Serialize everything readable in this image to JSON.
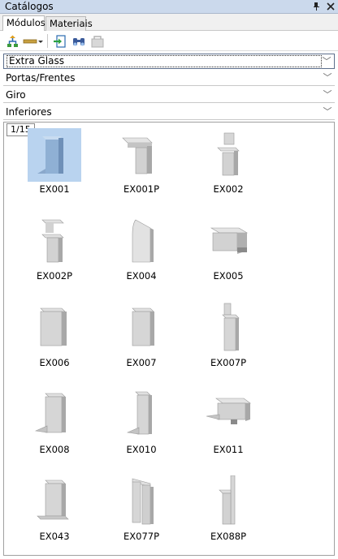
{
  "window": {
    "title": "Catálogos",
    "pin_icon": "pin-icon",
    "close_icon": "close-icon"
  },
  "tabs": [
    {
      "label": "Módulos",
      "active": true
    },
    {
      "label": "Materiais",
      "active": false
    }
  ],
  "toolbar": {
    "buttons": [
      "tree-up-icon",
      "ruler-dropdown-icon",
      "insert-icon",
      "binoculars-icon",
      "module-disabled-icon"
    ]
  },
  "filters": [
    {
      "value": "Extra Glass",
      "selected": true
    },
    {
      "value": "Portas/Frentes",
      "selected": false
    },
    {
      "value": "Giro",
      "selected": false
    },
    {
      "value": "Inferiores",
      "selected": false
    }
  ],
  "gallery": {
    "page_indicator": "1/15",
    "items": [
      {
        "label": "EX001",
        "selected": true
      },
      {
        "label": "EX001P",
        "selected": false
      },
      {
        "label": "EX002",
        "selected": false
      },
      {
        "label": "EX002P",
        "selected": false
      },
      {
        "label": "EX004",
        "selected": false
      },
      {
        "label": "EX005",
        "selected": false
      },
      {
        "label": "EX006",
        "selected": false
      },
      {
        "label": "EX007",
        "selected": false
      },
      {
        "label": "EX007P",
        "selected": false
      },
      {
        "label": "EX008",
        "selected": false
      },
      {
        "label": "EX010",
        "selected": false
      },
      {
        "label": "EX011",
        "selected": false
      },
      {
        "label": "EX043",
        "selected": false
      },
      {
        "label": "EX077P",
        "selected": false
      },
      {
        "label": "EX088P",
        "selected": false
      }
    ]
  }
}
